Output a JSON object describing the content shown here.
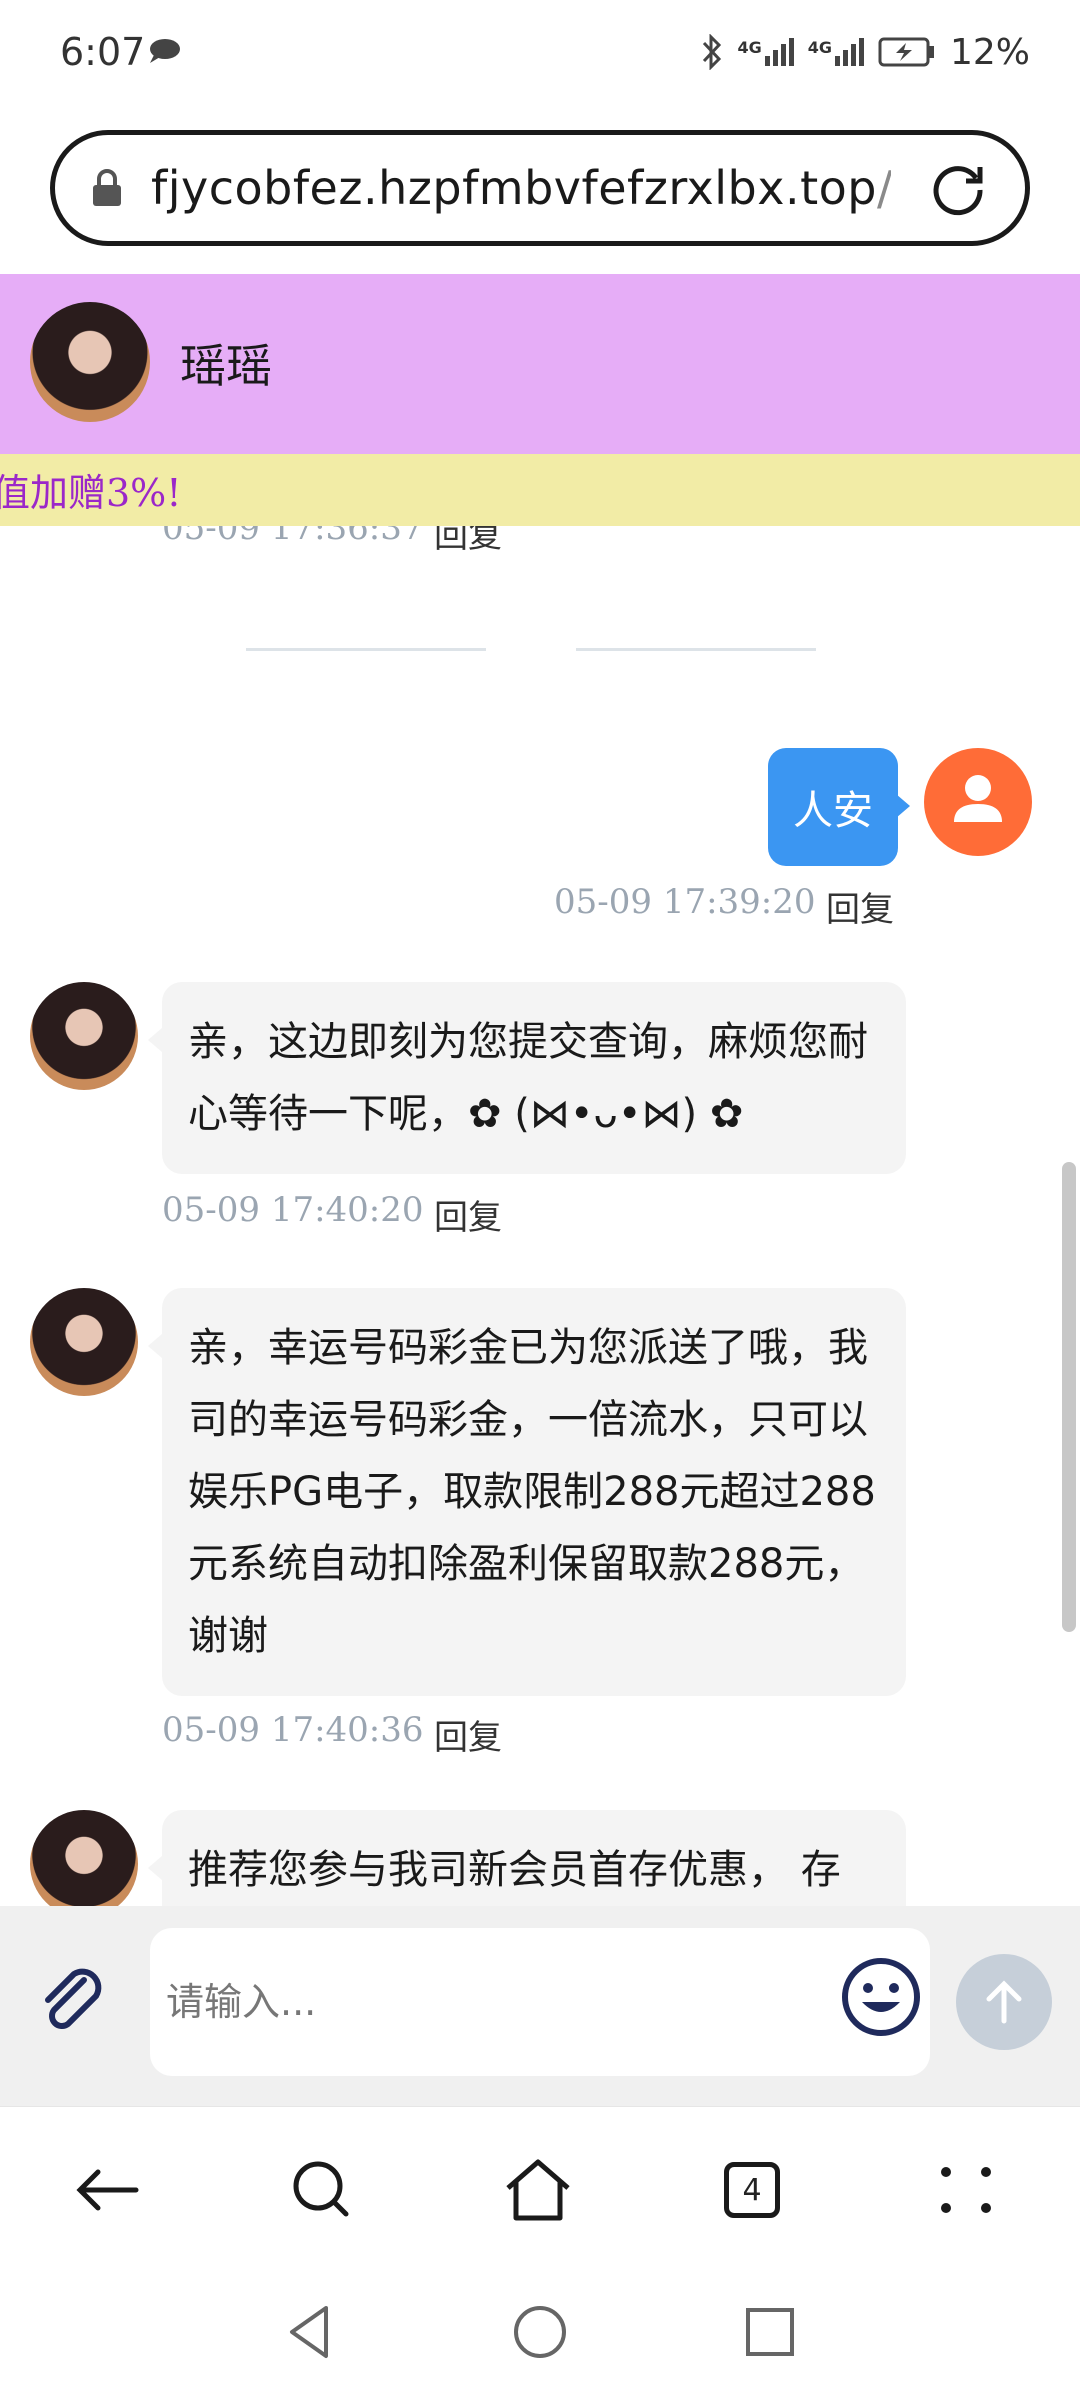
{
  "status_bar": {
    "time": "6:07",
    "battery": "12%",
    "signal1": "4G",
    "signal2": "4G"
  },
  "browser": {
    "url_main": "fjycobfez.hzpfmbvfefzrxlbx.top",
    "url_fade": "/ac",
    "tab_count": "4"
  },
  "chat": {
    "agent_name": "瑶瑶",
    "marquee": "值加赠3%!",
    "partial_timestamp": "05-09 17:36:37",
    "reply_label": "回复",
    "messages": [
      {
        "sender": "user",
        "text": "人安",
        "time": "05-09 17:39:20"
      },
      {
        "sender": "agent",
        "text": "亲，这边即刻为您提交查询，麻烦您耐心等待一下呢，✿ (⋈•ᴗ•⋈) ✿",
        "time": "05-09 17:40:20"
      },
      {
        "sender": "agent",
        "text": "亲，幸运号码彩金已为您派送了哦，我司的幸运号码彩金，一倍流水，只可以娱乐PG电子，取款限制288元超过288元系统自动扣除盈利保留取款288元，谢谢",
        "time": "05-09 17:40:36"
      },
      {
        "sender": "agent",
        "text": "推荐您参与我司新会员首存优惠， 存"
      }
    ]
  },
  "composer": {
    "placeholder": "请输入..."
  },
  "colors": {
    "header_bg": "#e6adf7",
    "marquee_bg": "#f2eca6",
    "marquee_text": "#9b27c9",
    "user_bubble": "#3b96f2",
    "user_avatar": "#ff6c37",
    "agent_bubble": "#f4f4f4"
  }
}
